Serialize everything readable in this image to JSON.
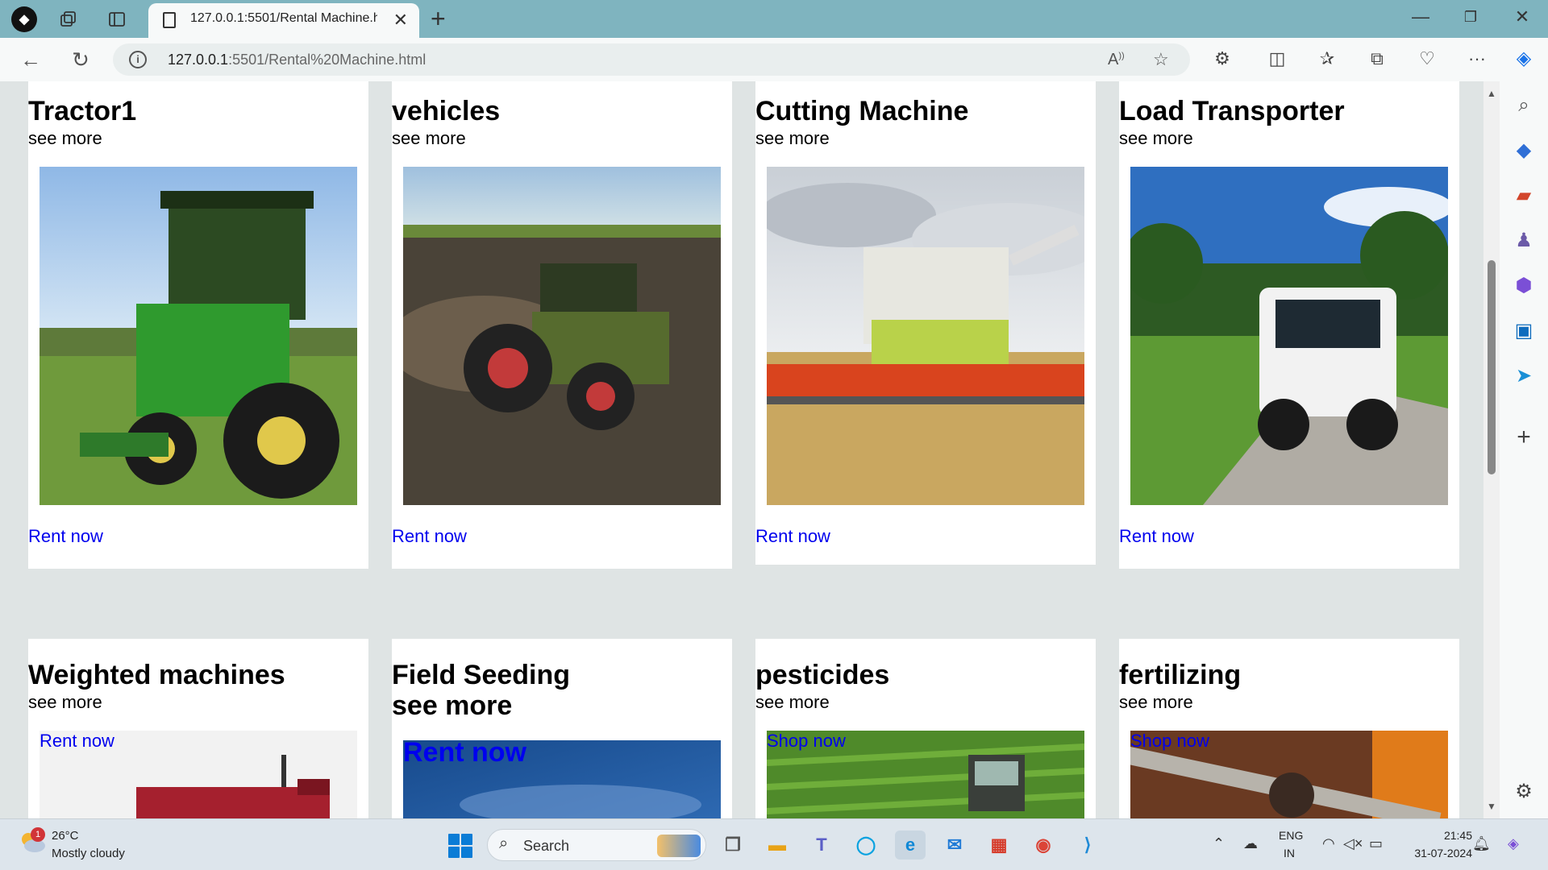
{
  "browser": {
    "tab_title": "127.0.0.1:5501/Rental Machine.html",
    "url_host": "127.0.0.1",
    "url_rest": ":5501/Rental%20Machine.html"
  },
  "cards_row1": [
    {
      "title": "Tractor1",
      "sub": "see more",
      "link": "Rent now"
    },
    {
      "title": "vehicles",
      "sub": "see more",
      "link": "Rent now"
    },
    {
      "title": "Cutting Machine",
      "sub": "see more",
      "link": "Rent now"
    },
    {
      "title": "Load Transporter",
      "sub": "see more",
      "link": "Rent now"
    }
  ],
  "cards_row2": [
    {
      "title": "Weighted machines",
      "sub": "see more",
      "link": "Rent now"
    },
    {
      "title": "Field Seeding",
      "sub": "see more",
      "link": "Rent now"
    },
    {
      "title": "pesticides",
      "sub": "see more",
      "link": "Shop now"
    },
    {
      "title": "fertilizing",
      "sub": "see more",
      "link": "Shop now"
    }
  ],
  "taskbar": {
    "weather_badge": "1",
    "temperature": "26°C",
    "weather": "Mostly cloudy",
    "search": "Search",
    "lang_1": "ENG",
    "lang_2": "IN",
    "time": "21:45",
    "date": "31-07-2024"
  },
  "icons": {
    "profile": "profile-avatar-icon",
    "workspaces": "workspaces-icon",
    "tab_actions": "vertical-tabs-icon"
  }
}
